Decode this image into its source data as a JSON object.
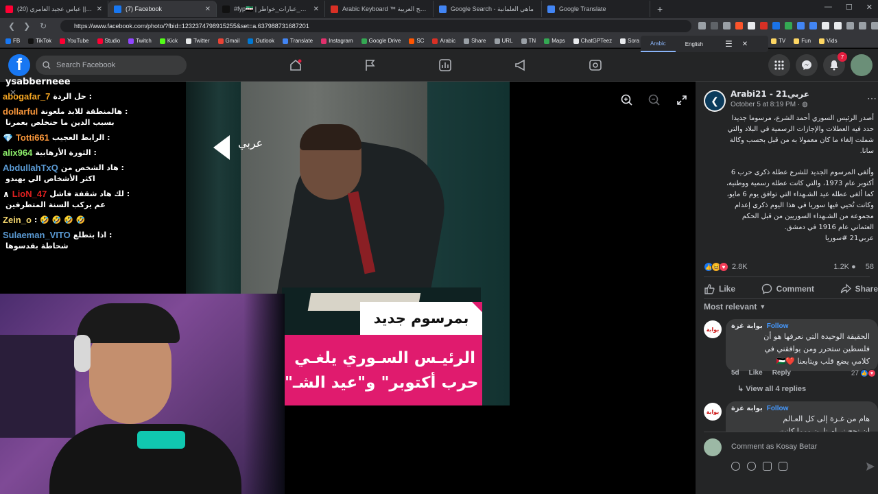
{
  "browser": {
    "tabs": [
      {
        "label": "(20) اجمل ساقي || عباس عجيد العامري",
        "color": "#ff0033"
      },
      {
        "label": "(7) Facebook",
        "color": "#1877f2",
        "active": true
      },
      {
        "label": "#fyp🇸🇾 | اقتباسات_عبارات_خواطر# | TikT",
        "color": "#111111"
      },
      {
        "label": "Arabic Keyboard ™ لوحة المفاتيح العربية",
        "color": "#d93025"
      },
      {
        "label": "Google Search - ماهي العلمانية",
        "color": "#4285f4"
      },
      {
        "label": "Google Translate",
        "color": "#4285f4"
      }
    ],
    "url": "https://www.facebook.com/photo/?fbid=1232374798915255&set=a.637988731687201",
    "bookmarks": [
      {
        "label": "FB",
        "color": "#1877f2"
      },
      {
        "label": "TikTok",
        "color": "#111111"
      },
      {
        "label": "YouTube",
        "color": "#ff0033"
      },
      {
        "label": "Studio",
        "color": "#ff0033"
      },
      {
        "label": "Twitch",
        "color": "#9146ff"
      },
      {
        "label": "Kick",
        "color": "#53fc18"
      },
      {
        "label": "Twitter",
        "color": "#e7e9ea"
      },
      {
        "label": "Gmail",
        "color": "#ea4335"
      },
      {
        "label": "Outlook",
        "color": "#0078d4"
      },
      {
        "label": "Translate",
        "color": "#4285f4"
      },
      {
        "label": "Instagram",
        "color": "#e1306c"
      },
      {
        "label": "Google Drive",
        "color": "#34a853"
      },
      {
        "label": "SC",
        "color": "#ff5500"
      },
      {
        "label": "Arabic",
        "color": "#d93025"
      },
      {
        "label": "Share",
        "color": "#9aa0a6"
      },
      {
        "label": "URL",
        "color": "#9aa0a6"
      },
      {
        "label": "TN",
        "color": "#9aa0a6"
      },
      {
        "label": "Maps",
        "color": "#34a853"
      },
      {
        "label": "ChatGPTeez",
        "color": "#e8eaed"
      },
      {
        "label": "Sora",
        "color": "#e8eaed"
      }
    ],
    "bookmarks_right": [
      "TV",
      "Fun",
      "Vids"
    ],
    "translate_popup": {
      "lang1": "Arabic",
      "lang2": "English"
    }
  },
  "facebook": {
    "search_placeholder": "Search Facebook",
    "notifications_count": "7",
    "post": {
      "page_name": "Arabi21 - عربي21",
      "date": "October 5 at 8:19 PM · ",
      "text_lines_p1": [
        "أصدر الرئيس السوري أحمد الشرع، مرسوما جديدا",
        "حدد فيه العطلات والإجازات الرسمية في البلاد والتي",
        "شملت إلغاء ما كان معمولا به من قبل بحسب وكالة",
        "سانا."
      ],
      "text_lines_p2": [
        "وألغى المرسوم الجديد للشرع عطلة ذكرى حرب 6",
        "أكتوبر عام 1973، والتي كانت عطلة رسمية ووطنية،",
        "كما ألغى عطلة عيد الشـهداء التي توافق يوم 6 مايو،",
        "وكانت تُحيي فيها سوريا في هذا اليوم ذكرى إعدام",
        "مجموعة من الشـهداء السوريين من قبل الحكم",
        "العثماني عام 1916 في دمشق.",
        "عربي21 #سوريا"
      ],
      "reactions_count": "2.8K",
      "comments_count": "1.2K",
      "shares_count": "58",
      "like_label": "Like",
      "comment_label": "Comment",
      "share_label": "Share",
      "sort_label": "Most relevant"
    },
    "comments": [
      {
        "avatar_text": "بوابة",
        "author": "بوابة غزة",
        "follow": "Follow",
        "lines": [
          "الحقيقة الوحيدة التي نعرفها هو أن",
          "فلسطين ستحرر ومن يوافقني في",
          "كلامي يضع قلب ويتابعنا ❤️🇵🇸"
        ],
        "time": "5d",
        "like": "Like",
        "reply": "Reply",
        "likes": "27",
        "view_replies": "View all 4 replies"
      },
      {
        "avatar_text": "بوابة",
        "author": "بوابة غزة",
        "follow": "Follow",
        "lines": [
          "هام من غـزة إلى كل العـالم",
          "إن نجح نيرام نلرن مهما كانت"
        ]
      }
    ],
    "composer_placeholder": "Comment as Kosay Betar"
  },
  "photo": {
    "logo_text": "عربي",
    "banner_top": "بمرسوم جديد",
    "banner_line1": "الرئيـس السـوري يلغـي",
    "banner_line2": "\"حرب أكتوبر\" و\"عيد الشـ"
  },
  "chat": {
    "header": "ysabberneee",
    "messages": [
      {
        "user": "abogafar_7",
        "user_color": "#f5a623",
        "msg": "حل الردة :"
      },
      {
        "user": "dollarful",
        "user_color": "#ff9a3c",
        "msg": "هالمنطقة للابد ملعونة :",
        "cont": "بسبب الدين ما حنخلص بعمرنا"
      },
      {
        "user": "Totti661",
        "user_color": "#ff9a3c",
        "msg": "الرابط العجيب :",
        "badge": "💎"
      },
      {
        "user": "alix964",
        "user_color": "#8ef06c",
        "msg": "الثورة الأرهابية :"
      },
      {
        "user": "AbdullahTxQ",
        "user_color": "#5b9bd5",
        "msg": "هاد الشخص من :",
        "cont": "اكثر الأشخاص الي بهبدو"
      },
      {
        "user": "LioN_47",
        "user_color": "#e02020",
        "msg": "لك هاد شقفة فاشل :",
        "prefix": "∧",
        "cont": "عم يركب السنة المتطرفين"
      },
      {
        "user": "Zein_o",
        "user_color": "#f5d76e",
        "msg": ": 🤣 🤣 🤣 🤣"
      },
      {
        "user": "Sulaeman_VITO",
        "user_color": "#5b9bd5",
        "msg": "اذا بتطلع :",
        "cont": "شحاطة بقدسوها"
      }
    ]
  }
}
